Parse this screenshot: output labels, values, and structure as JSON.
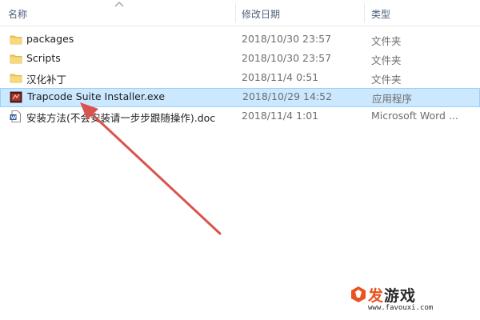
{
  "columns": {
    "name": "名称",
    "date": "修改日期",
    "type": "类型"
  },
  "files": [
    {
      "name": "packages",
      "date": "2018/10/30 23:57",
      "type": "文件夹",
      "icon": "folder-icon"
    },
    {
      "name": "Scripts",
      "date": "2018/10/30 23:57",
      "type": "文件夹",
      "icon": "folder-icon"
    },
    {
      "name": "汉化补丁",
      "date": "2018/11/4 0:51",
      "type": "文件夹",
      "icon": "folder-icon"
    },
    {
      "name": "Trapcode Suite Installer.exe",
      "date": "2018/10/29 14:52",
      "type": "应用程序",
      "icon": "exe-icon",
      "selected": true
    },
    {
      "name": "安装方法(不会安装请一步步跟随操作).doc",
      "date": "2018/11/4 1:01",
      "type": "Microsoft Word ...",
      "icon": "word-doc-icon"
    }
  ],
  "watermark": {
    "brand_accent": "发",
    "brand_rest": "游戏",
    "url": "www.favouxi.com"
  },
  "colors": {
    "selection": "#cce8ff",
    "selection_border": "#99d1ff",
    "arrow": "#d9534f",
    "folder": "#f4c95d"
  }
}
